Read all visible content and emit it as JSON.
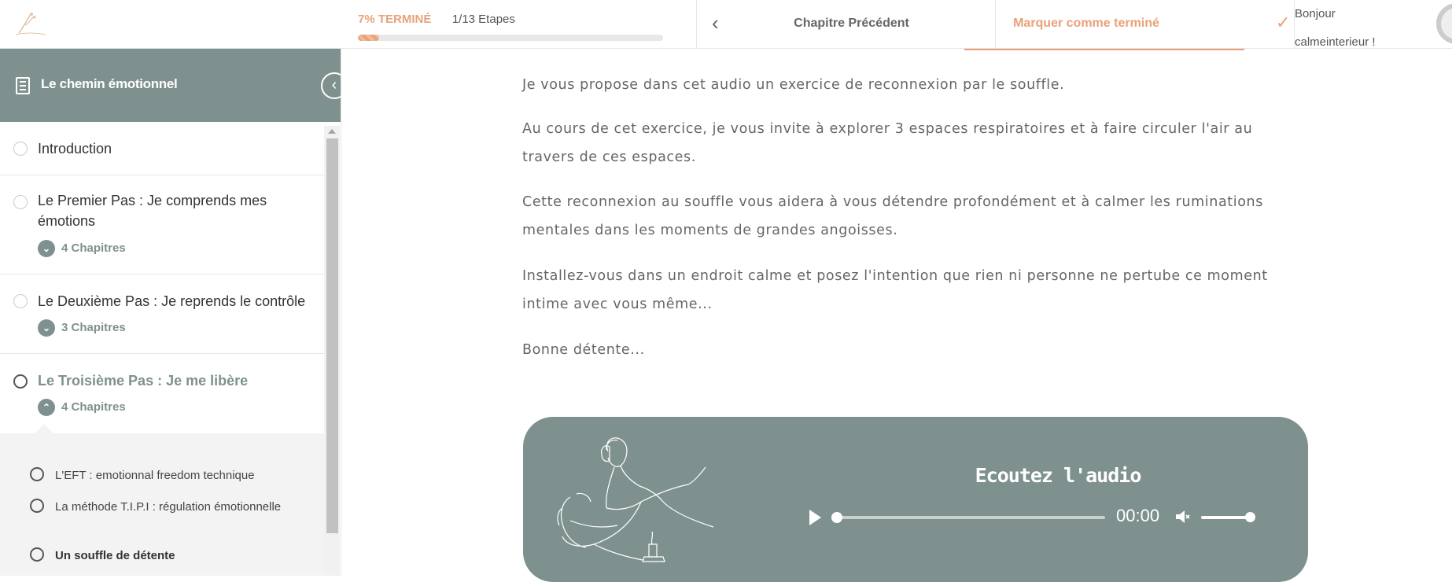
{
  "header": {
    "progress_percent_label": "7% TERMINÉ",
    "progress_fraction": 0.07,
    "steps_label": "1/13 Etapes",
    "prev_label": "Chapitre Précédent",
    "mark_done_label": "Marquer comme terminé",
    "greeting_line1": "Bonjour",
    "greeting_line2": "calmeinterieur !"
  },
  "sidebar": {
    "title": "Le chemin émotionnel",
    "items": [
      {
        "label": "Introduction"
      },
      {
        "label": "Le Premier Pas : Je comprends mes émotions",
        "chapters": "4 Chapitres"
      },
      {
        "label": "Le Deuxième Pas : Je reprends le contrôle",
        "chapters": "3 Chapitres"
      },
      {
        "label": "Le Troisième Pas : Je me libère",
        "chapters": "4 Chapitres"
      }
    ],
    "sub_items": [
      {
        "label": "L'EFT : emotionnal freedom technique"
      },
      {
        "label": "La méthode T.I.P.I : régulation émotionnelle"
      },
      {
        "label": "Un souffle de détente"
      }
    ]
  },
  "content": {
    "paragraphs": [
      "Je vous propose dans cet audio un exercice de reconnexion par le souffle.",
      "Au cours de cet exercice, je vous invite à explorer 3 espaces respiratoires et à faire circuler l'air au travers de ces espaces.",
      "Cette reconnexion au souffle vous aidera à vous détendre profondément et à calmer les ruminations mentales dans les moments de grandes angoisses.",
      "Installez-vous dans un endroit calme et posez l'intention que rien ni personne ne pertube ce moment intime avec vous même...",
      "Bonne détente..."
    ],
    "audio": {
      "title": "Ecoutez l'audio",
      "time": "00:00",
      "volume_fraction": 1.0
    }
  },
  "colors": {
    "accent": "#e8a27a",
    "sage": "#7f918f"
  }
}
